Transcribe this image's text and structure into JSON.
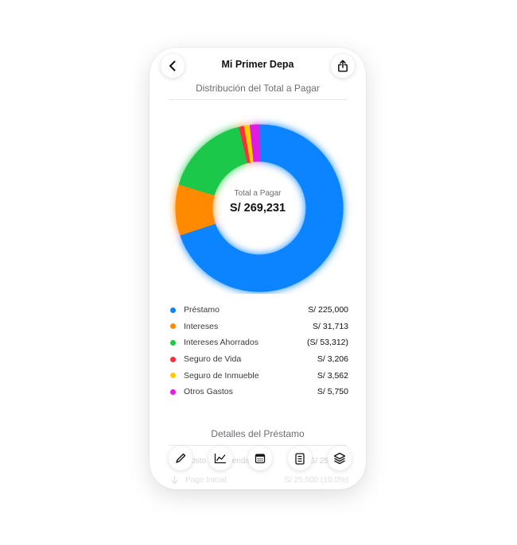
{
  "header": {
    "title": "Mi Primer Depa",
    "back_icon": "chevron-left-icon",
    "share_icon": "share-icon"
  },
  "chart_section": {
    "subtitle": "Distribución del Total a Pagar",
    "center_label": "Total a Pagar",
    "center_value": "S/ 269,231"
  },
  "chart_data": {
    "type": "pie",
    "title": "Distribución del Total a Pagar",
    "center_label": "Total a Pagar",
    "center_value": "S/ 269,231",
    "slices": [
      {
        "label": "Préstamo",
        "value": 225000,
        "display": "S/ 225,000",
        "color": "#0a84ff"
      },
      {
        "label": "Intereses",
        "value": 31713,
        "display": "S/ 31,713",
        "color": "#ff8a00"
      },
      {
        "label": "Intereses Ahorrados",
        "value": 53312,
        "display": "(S/ 53,312)",
        "color": "#1fc84a"
      },
      {
        "label": "Seguro de Vida",
        "value": 3206,
        "display": "S/ 3,206",
        "color": "#ff2d3a"
      },
      {
        "label": "Seguro de Inmueble",
        "value": 3562,
        "display": "S/ 3,562",
        "color": "#ffcc00"
      },
      {
        "label": "Otros Gastos",
        "value": 5750,
        "display": "S/ 5,750",
        "color": "#e01ee0"
      }
    ]
  },
  "details": {
    "title": "Detalles del Préstamo",
    "rows": [
      {
        "label": "Costo de Vivienda",
        "value": "S/ 250,000",
        "icon": "house-icon"
      },
      {
        "label": "Pago Inicial",
        "value": "S/ 25,000 (10.0%)",
        "icon": "arrow-down-icon"
      }
    ]
  },
  "toolbar": {
    "items": [
      {
        "name": "edit",
        "icon": "pencil-icon"
      },
      {
        "name": "chart",
        "icon": "line-chart-icon"
      },
      {
        "name": "calendar",
        "icon": "calendar-icon"
      },
      {
        "name": "document",
        "icon": "document-icon"
      },
      {
        "name": "layers",
        "icon": "layers-icon"
      }
    ]
  }
}
